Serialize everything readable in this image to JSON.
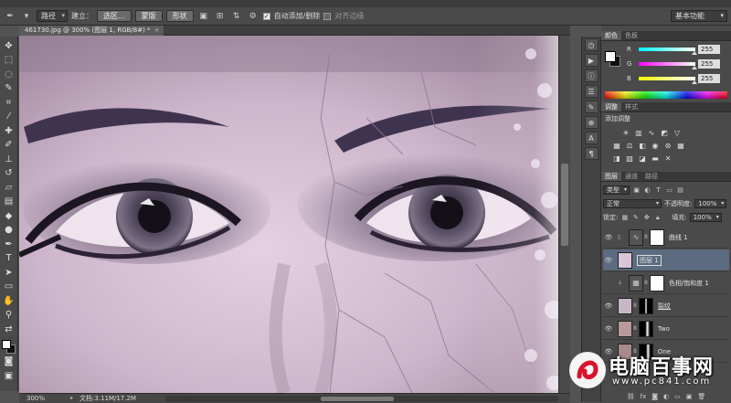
{
  "options_bar": {
    "path_mode": "路径",
    "build_label": "建立：",
    "selection_button": "选区...",
    "mask_button": "蒙版",
    "shape_button": "形状",
    "auto_add_delete": "自动添加/删除",
    "align_edges": "对齐边缘",
    "workspace": "基本功能"
  },
  "document": {
    "tab_title": "461730.jpg @ 300% (图层 1, RGB/8#) *",
    "zoom": "300%",
    "doc_info": "文档:3.11M/17.2M"
  },
  "color_panel": {
    "tabs": [
      "颜色",
      "色板"
    ],
    "r_label": "R",
    "g_label": "G",
    "b_label": "B",
    "r_value": "255",
    "g_value": "255",
    "b_value": "255"
  },
  "adjustments_panel": {
    "tabs": [
      "调整",
      "样式"
    ],
    "title": "添加调整"
  },
  "layers_panel": {
    "tabs": [
      "图层",
      "通道",
      "路径"
    ],
    "filter_kind": "类型",
    "blend_mode": "正常",
    "opacity_label": "不透明度:",
    "opacity_value": "100%",
    "lock_label": "锁定:",
    "fill_label": "填充:",
    "fill_value": "100%",
    "layers": [
      {
        "name": "曲线 1",
        "selected": false
      },
      {
        "name": "图层 1",
        "selected": true
      },
      {
        "name": "色相/饱和度 1",
        "selected": false
      },
      {
        "name": "裂纹",
        "selected": false
      },
      {
        "name": "Two",
        "selected": false
      },
      {
        "name": "One",
        "selected": false
      }
    ]
  },
  "watermark": {
    "title": "电脑百事网",
    "url": "www.pc841.com"
  },
  "colors": {
    "accent_selected_layer": "#5b6b80",
    "r_track": "#00e0ff",
    "g_track": "#ff20ff",
    "b_track": "#ffff20"
  }
}
